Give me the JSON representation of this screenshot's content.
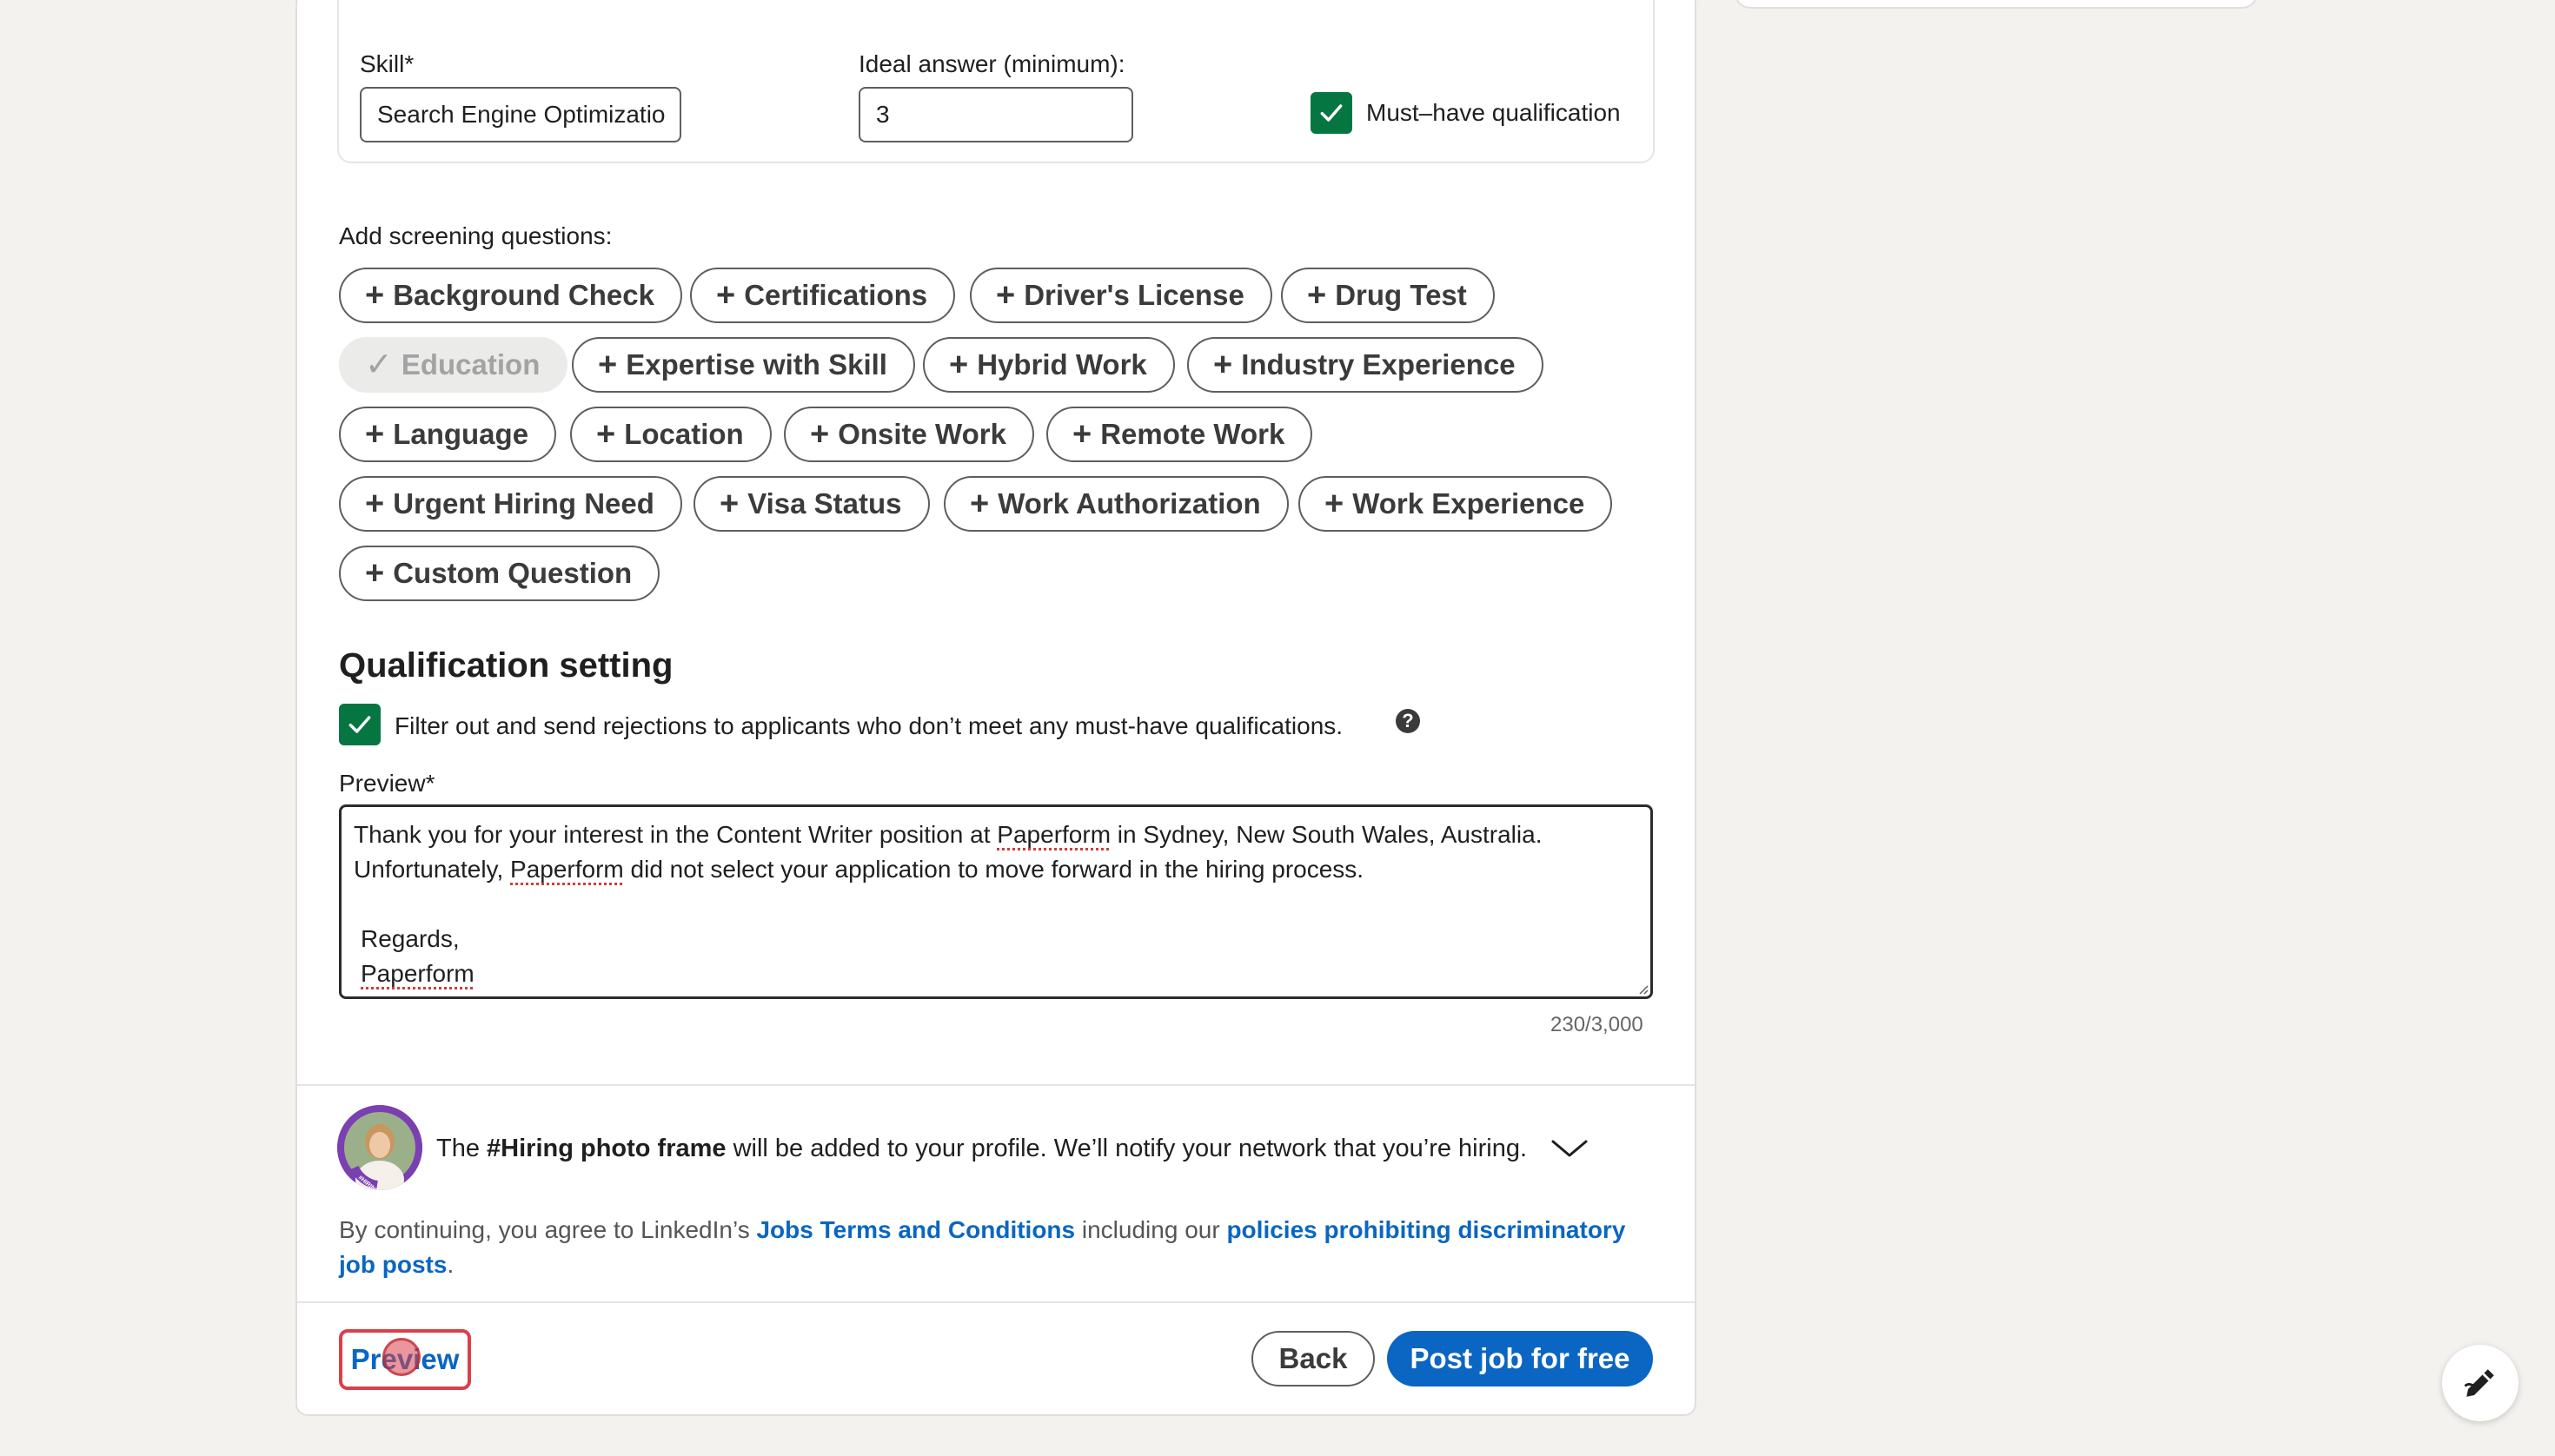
{
  "skill": {
    "label": "Skill*",
    "value": "Search Engine Optimizatio",
    "ideal_label": "Ideal answer (minimum):",
    "ideal_value": "3",
    "must_have_label": "Must–have qualification"
  },
  "screening": {
    "title": "Add screening questions:",
    "pills": [
      {
        "label": "Background Check",
        "prefix": "+"
      },
      {
        "label": "Certifications",
        "prefix": "+"
      },
      {
        "label": "Driver's License",
        "prefix": "+"
      },
      {
        "label": "Drug Test",
        "prefix": "+"
      },
      {
        "label": "Education",
        "prefix": "✓"
      },
      {
        "label": "Expertise with Skill",
        "prefix": "+"
      },
      {
        "label": "Hybrid Work",
        "prefix": "+"
      },
      {
        "label": "Industry Experience",
        "prefix": "+"
      },
      {
        "label": "Language",
        "prefix": "+"
      },
      {
        "label": "Location",
        "prefix": "+"
      },
      {
        "label": "Onsite Work",
        "prefix": "+"
      },
      {
        "label": "Remote Work",
        "prefix": "+"
      },
      {
        "label": "Urgent Hiring Need",
        "prefix": "+"
      },
      {
        "label": "Visa Status",
        "prefix": "+"
      },
      {
        "label": "Work Authorization",
        "prefix": "+"
      },
      {
        "label": "Work Experience",
        "prefix": "+"
      },
      {
        "label": "Custom Question",
        "prefix": "+"
      }
    ]
  },
  "qualification": {
    "title": "Qualification setting",
    "filter_label": "Filter out and send rejections to applicants who don’t meet any must-have qualifications.",
    "help": "?",
    "preview_label": "Preview*",
    "preview_line1_a": "Thank you for your interest in the Content Writer position at ",
    "preview_company": "Paperform",
    "preview_line1_b": " in Sydney, New South Wales, Australia.",
    "preview_line2_a": "Unfortunately, ",
    "preview_line2_b": " did not select your application to move forward in the hiring process.",
    "preview_regards": "Regards,",
    "char_count": "230/3,000"
  },
  "hiring_frame": {
    "text_a": "The ",
    "text_bold": "#Hiring photo frame",
    "text_b": " will be added to your profile. We’ll notify your network that you’re hiring.",
    "avatar_badge": "#HIRING"
  },
  "terms": {
    "text_a": "By continuing, you agree to LinkedIn’s ",
    "link1": "Jobs Terms and Conditions",
    "text_b": " including our ",
    "link2a": "policies prohibiting discriminatory",
    "link2b": "job posts",
    "text_c": "."
  },
  "footer": {
    "preview_button": "Preview",
    "back_button": "Back",
    "post_button": "Post job for free"
  },
  "colors": {
    "accent": "#0a66c2",
    "check_green": "#057642",
    "highlight_red": "#d9404a"
  }
}
